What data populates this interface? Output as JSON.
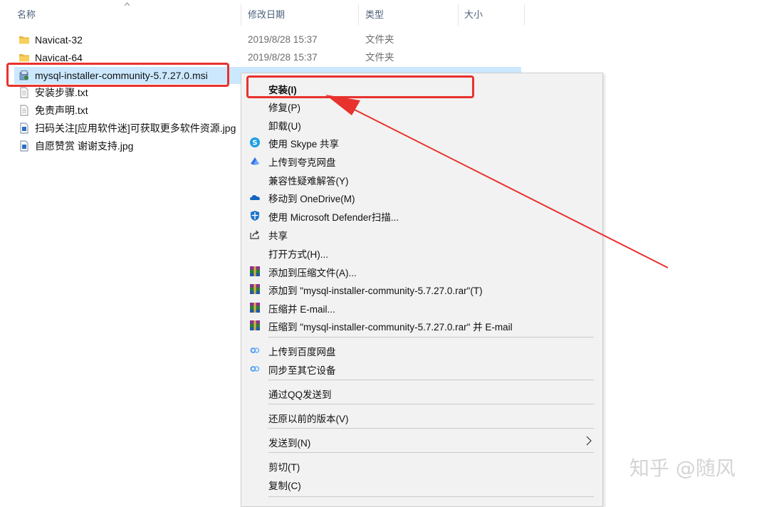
{
  "columns": {
    "name": "名称",
    "modified": "修改日期",
    "type": "类型",
    "size": "大小"
  },
  "files": [
    {
      "name": "Navicat-32",
      "date": "2019/8/28 15:37",
      "type": "文件夹",
      "icon": "folder-icon"
    },
    {
      "name": "Navicat-64",
      "date": "2019/8/28 15:37",
      "type": "文件夹",
      "icon": "folder-icon"
    },
    {
      "name": "mysql-installer-community-5.7.27.0.msi",
      "date": "",
      "type": "",
      "icon": "msi-installer-icon",
      "selected": true
    },
    {
      "name": "安装步骤.txt",
      "date": "",
      "type": "",
      "icon": "text-file-icon"
    },
    {
      "name": "免责声明.txt",
      "date": "",
      "type": "",
      "icon": "text-file-icon"
    },
    {
      "name": "扫码关注[应用软件迷]可获取更多软件资源.jpg",
      "date": "",
      "type": "",
      "icon": "image-file-icon"
    },
    {
      "name": "自愿赞赏 谢谢支持.jpg",
      "date": "",
      "type": "",
      "icon": "image-file-icon"
    }
  ],
  "context_menu": {
    "items": [
      {
        "label": "安装(I)",
        "icon": "",
        "bold": true
      },
      {
        "label": "修复(P)",
        "icon": ""
      },
      {
        "label": "卸载(U)",
        "icon": ""
      },
      {
        "label": "使用 Skype 共享",
        "icon": "skype-icon"
      },
      {
        "label": "上传到夸克网盘",
        "icon": "quark-cloud-icon"
      },
      {
        "label": "兼容性疑难解答(Y)",
        "icon": ""
      },
      {
        "label": "移动到 OneDrive(M)",
        "icon": "onedrive-icon"
      },
      {
        "label": "使用 Microsoft Defender扫描...",
        "icon": "defender-shield-icon"
      },
      {
        "label": "共享",
        "icon": "share-icon"
      },
      {
        "label": "打开方式(H)...",
        "icon": ""
      },
      {
        "label": "添加到压缩文件(A)...",
        "icon": "winrar-icon"
      },
      {
        "label": "添加到 \"mysql-installer-community-5.7.27.0.rar\"(T)",
        "icon": "winrar-icon"
      },
      {
        "label": "压缩并 E-mail...",
        "icon": "winrar-icon"
      },
      {
        "label": "压缩到 \"mysql-installer-community-5.7.27.0.rar\" 并 E-mail",
        "icon": "winrar-icon"
      },
      {
        "label": "上传到百度网盘",
        "icon": "baidu-netdisk-icon"
      },
      {
        "label": "同步至其它设备",
        "icon": "baidu-netdisk-icon"
      },
      {
        "label": "通过QQ发送到",
        "icon": ""
      },
      {
        "label": "还原以前的版本(V)",
        "icon": ""
      },
      {
        "label": "发送到(N)",
        "icon": "",
        "submenu": true
      },
      {
        "label": "剪切(T)",
        "icon": ""
      },
      {
        "label": "复制(C)",
        "icon": ""
      }
    ]
  },
  "watermark": "知乎 @随风",
  "colors": {
    "highlight_border": "#e8322e",
    "selection": "#cce8ff",
    "menu_bg": "#f2f2f2"
  }
}
